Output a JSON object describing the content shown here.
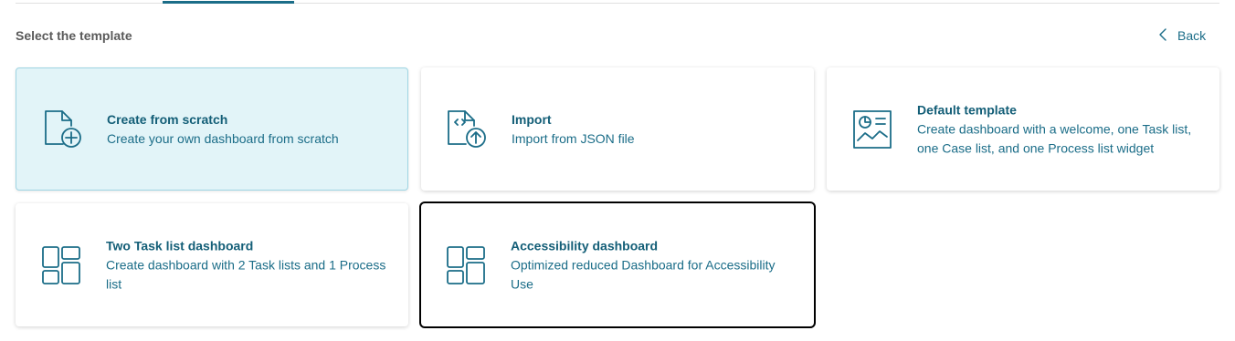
{
  "header": {
    "section_title": "Select the template",
    "back_label": "Back"
  },
  "cards": [
    {
      "title": "Create from scratch",
      "description": "Create your own dashboard from scratch",
      "icon": "file-add-icon",
      "state": "selected"
    },
    {
      "title": "Import",
      "description": "Import from JSON file",
      "icon": "file-upload-icon",
      "state": "default"
    },
    {
      "title": "Default template",
      "description": "Create dashboard with a welcome, one Task list, one Case list, and one Process list widget",
      "icon": "dashboard-chart-icon",
      "state": "default"
    },
    {
      "title": "Two Task list dashboard",
      "description": "Create dashboard with 2 Task lists and 1 Process list",
      "icon": "layout-grid-icon",
      "state": "default"
    },
    {
      "title": "Accessibility dashboard",
      "description": "Optimized reduced Dashboard for Accessibility Use",
      "icon": "layout-grid-icon",
      "state": "focused"
    }
  ],
  "colors": {
    "accent": "#1b6d88",
    "selected_bg": "#e2f4f8",
    "selected_border": "#9fd5e3"
  }
}
